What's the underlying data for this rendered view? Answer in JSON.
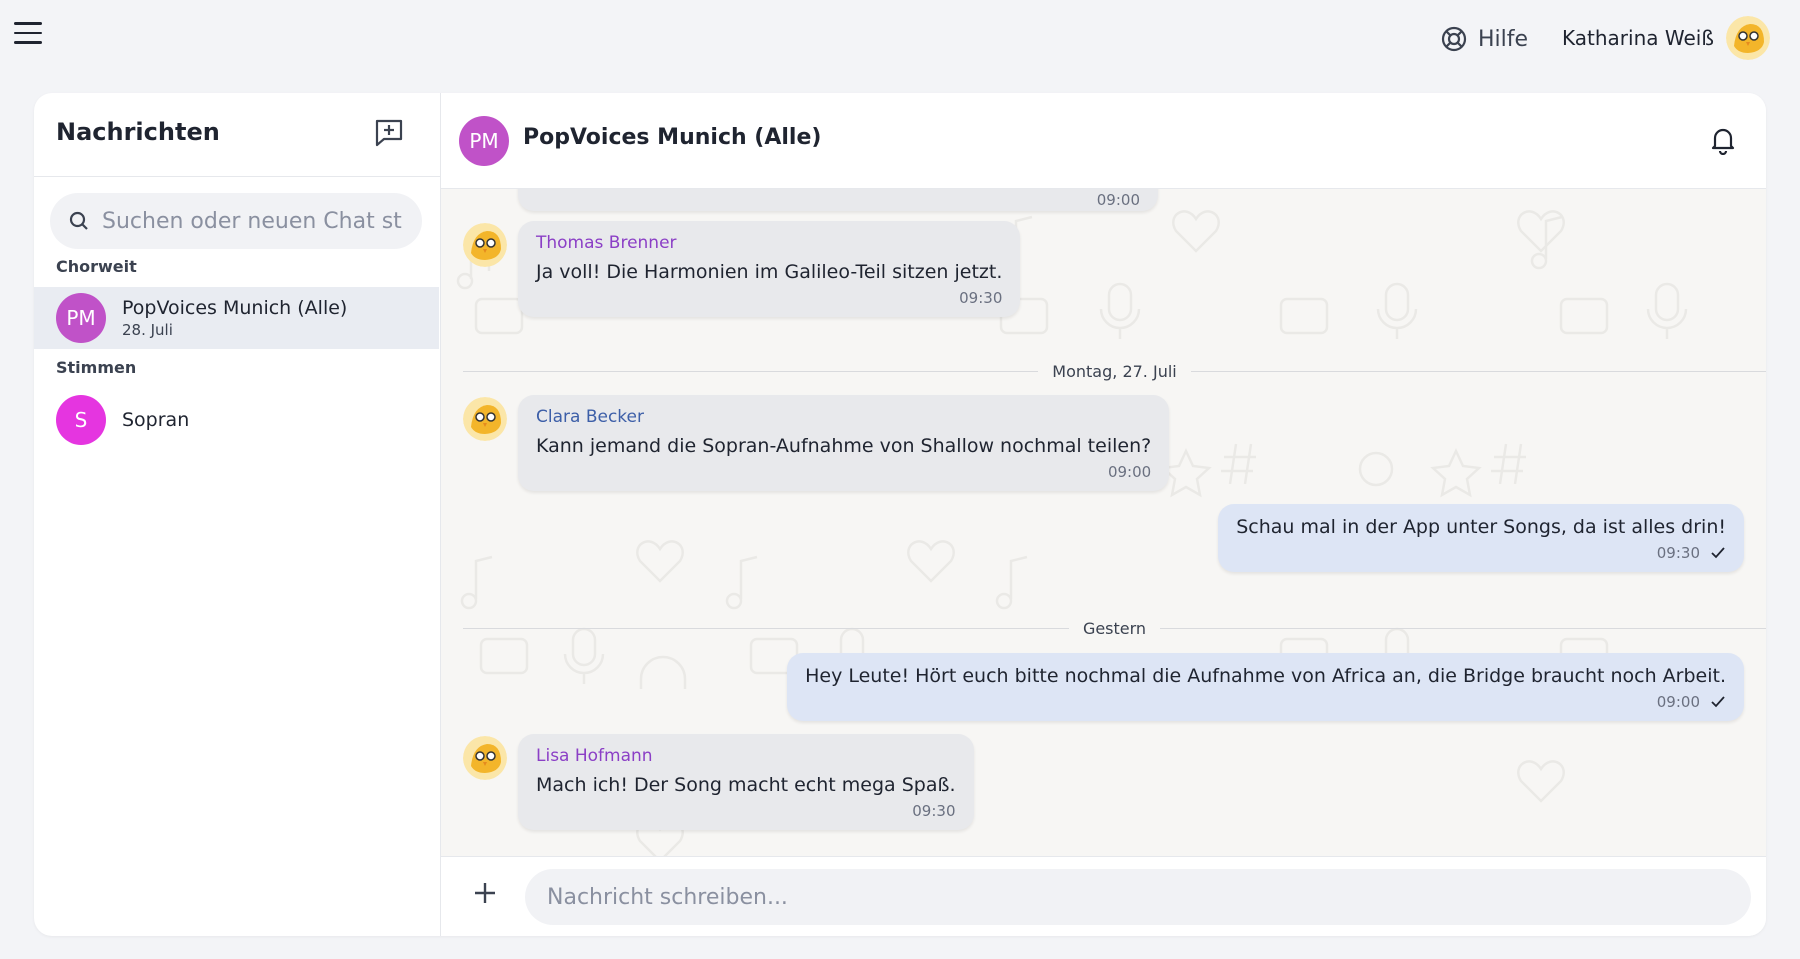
{
  "topbar": {
    "menu_icon": "hamburger-menu-icon",
    "help_label": "Hilfe",
    "help_icon": "lifebuoy-icon",
    "user_name": "Katharina Weiß"
  },
  "sidebar": {
    "title": "Nachrichten",
    "new_chat_icon": "new-chat-icon",
    "search_placeholder": "Suchen oder neuen Chat starten",
    "groups": [
      {
        "label": "Chorweit",
        "items": [
          {
            "initials": "PM",
            "name": "PopVoices Munich (Alle)",
            "date": "28. Juli",
            "color": "#c052c8",
            "active": true
          }
        ]
      },
      {
        "label": "Stimmen",
        "items": [
          {
            "initials": "S",
            "name": "Sopran",
            "date": "",
            "color": "#e535e0",
            "active": false
          }
        ]
      }
    ]
  },
  "chat": {
    "avatar_initials": "PM",
    "avatar_color": "#c052c8",
    "title": "PopVoices Munich (Alle)",
    "bell_icon": "bell-icon",
    "partial_top_time": "09:00",
    "messages": [
      {
        "sender": "Thomas Brenner",
        "sender_color": "#8b3fc6",
        "text": "Ja voll! Die Harmonien im Galileo-Teil sitzen jetzt.",
        "time": "09:30",
        "direction": "in"
      },
      {
        "separator": "Montag, 27. Juli"
      },
      {
        "sender": "Clara Becker",
        "sender_color": "#3d5fa8",
        "text": "Kann jemand die Sopran-Aufnahme von Shallow nochmal teilen?",
        "time": "09:00",
        "direction": "in"
      },
      {
        "sender": "",
        "text": "Schau mal in der App unter Songs, da ist alles drin!",
        "time": "09:30",
        "direction": "out"
      },
      {
        "separator": "Gestern"
      },
      {
        "sender": "",
        "text": "Hey Leute! Hört euch bitte nochmal die Aufnahme von Africa an, die Bridge braucht noch Arbeit.",
        "time": "09:00",
        "direction": "out"
      },
      {
        "sender": "Lisa Hofmann",
        "sender_color": "#8b3fc6",
        "text": "Mach ich! Der Song macht echt mega Spaß.",
        "time": "09:30",
        "direction": "in"
      }
    ]
  },
  "composer": {
    "attach_icon": "plus-icon",
    "placeholder": "Nachricht schreiben..."
  },
  "colors": {
    "incoming_bubble": "#e8e9ec",
    "outgoing_bubble": "#dde5f5",
    "background": "#f3f4f7"
  }
}
